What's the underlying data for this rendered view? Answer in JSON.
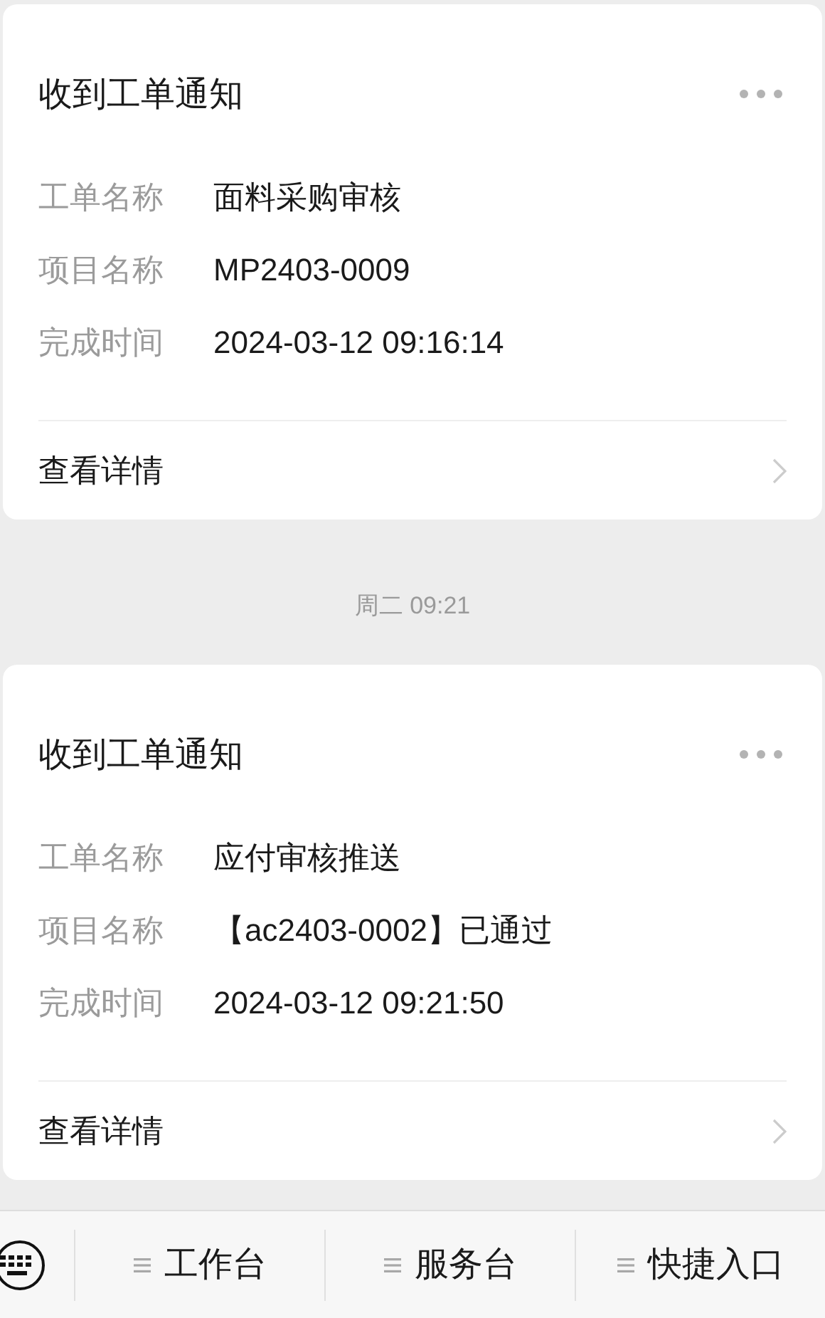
{
  "messages": [
    {
      "title": "收到工单通知",
      "fields": [
        {
          "label": "工单名称",
          "value": "面料采购审核"
        },
        {
          "label": "项目名称",
          "value": "MP2403-0009"
        },
        {
          "label": "完成时间",
          "value": "2024-03-12 09:16:14"
        }
      ],
      "link": "查看详情"
    },
    {
      "timestamp": "周二 09:21",
      "title": "收到工单通知",
      "fields": [
        {
          "label": "工单名称",
          "value": "应付审核推送"
        },
        {
          "label": "项目名称",
          "value": "【ac2403-0002】已通过"
        },
        {
          "label": "完成时间",
          "value": "2024-03-12 09:21:50"
        }
      ],
      "link": "查看详情"
    }
  ],
  "bottom_menu": [
    "工作台",
    "服务台",
    "快捷入口"
  ]
}
